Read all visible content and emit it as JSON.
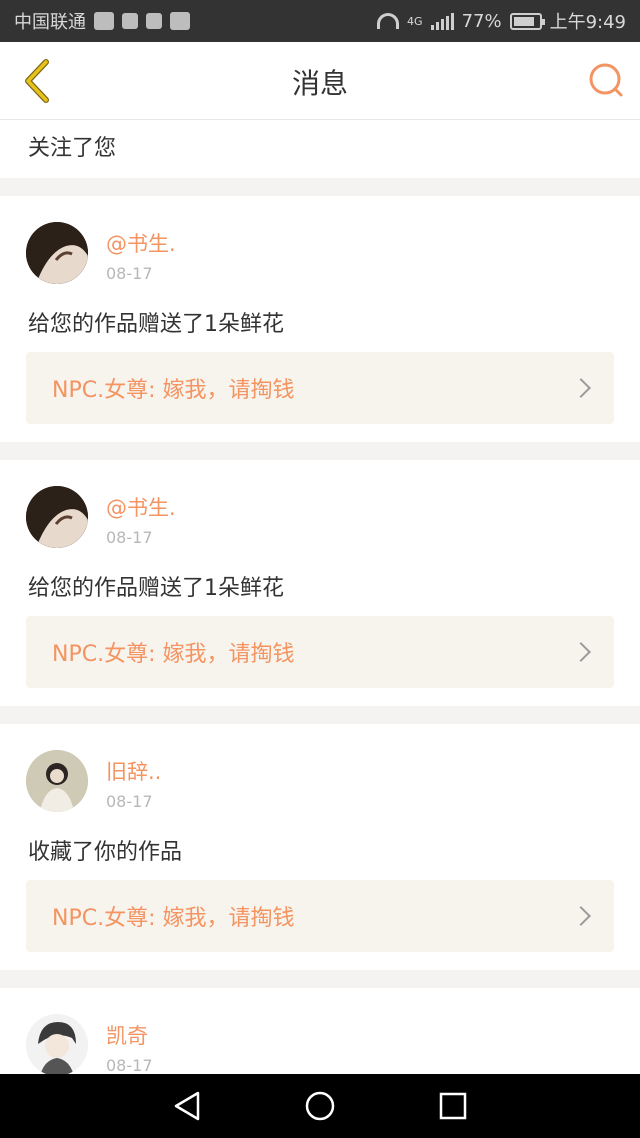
{
  "status_bar": {
    "carrier": "中国联通",
    "network": "4G",
    "battery": "77%",
    "time": "上午9:49"
  },
  "header": {
    "title": "消息",
    "back_icon": "chevron-left-icon",
    "search_icon": "search-icon"
  },
  "follow_notice": "关注了您",
  "messages": [
    {
      "username": "@书生.",
      "time": "08-17",
      "text": "给您的作品赠送了1朵鲜花",
      "work": "NPC.女尊: 嫁我，请掏钱"
    },
    {
      "username": "@书生.",
      "time": "08-17",
      "text": "给您的作品赠送了1朵鲜花",
      "work": "NPC.女尊: 嫁我，请掏钱"
    },
    {
      "username": "旧辞..",
      "time": "08-17",
      "text": "收藏了你的作品",
      "work": "NPC.女尊: 嫁我，请掏钱"
    },
    {
      "username": "凯奇",
      "time": "08-17"
    }
  ],
  "colors": {
    "accent": "#f39462",
    "back_yellow": "#e8c21b"
  }
}
